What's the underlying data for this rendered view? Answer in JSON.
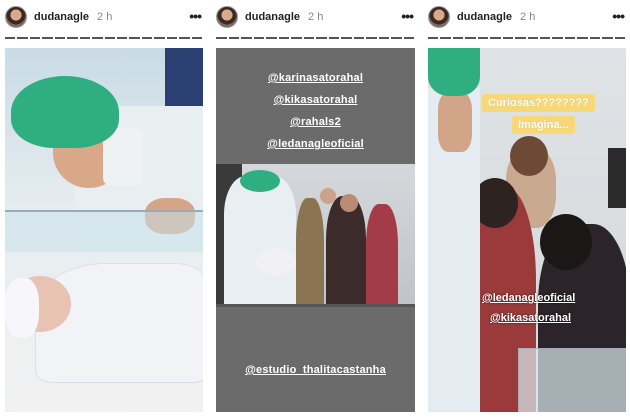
{
  "stories": [
    {
      "username": "dudanagle",
      "time": "2 h",
      "more_label": "•••",
      "tags": []
    },
    {
      "username": "dudanagle",
      "time": "2 h",
      "more_label": "•••",
      "tags": [
        "@karinasatorahal",
        "@kikasatorahal",
        "@rahals2",
        "@ledanagleoficial"
      ],
      "bottom_tag": "@estudio_thalitacastanha"
    },
    {
      "username": "dudanagle",
      "time": "2 h",
      "more_label": "•••",
      "caption_lines": [
        "Curiosas????????",
        "Imagina..."
      ],
      "tags": [
        "@ledanagleoficial",
        "@kikasatorahal"
      ]
    }
  ],
  "colors": {
    "scrub_cap": "#2fae82",
    "caption_bg": "#f7d777",
    "story_bg_2": "#6b6b6b"
  }
}
